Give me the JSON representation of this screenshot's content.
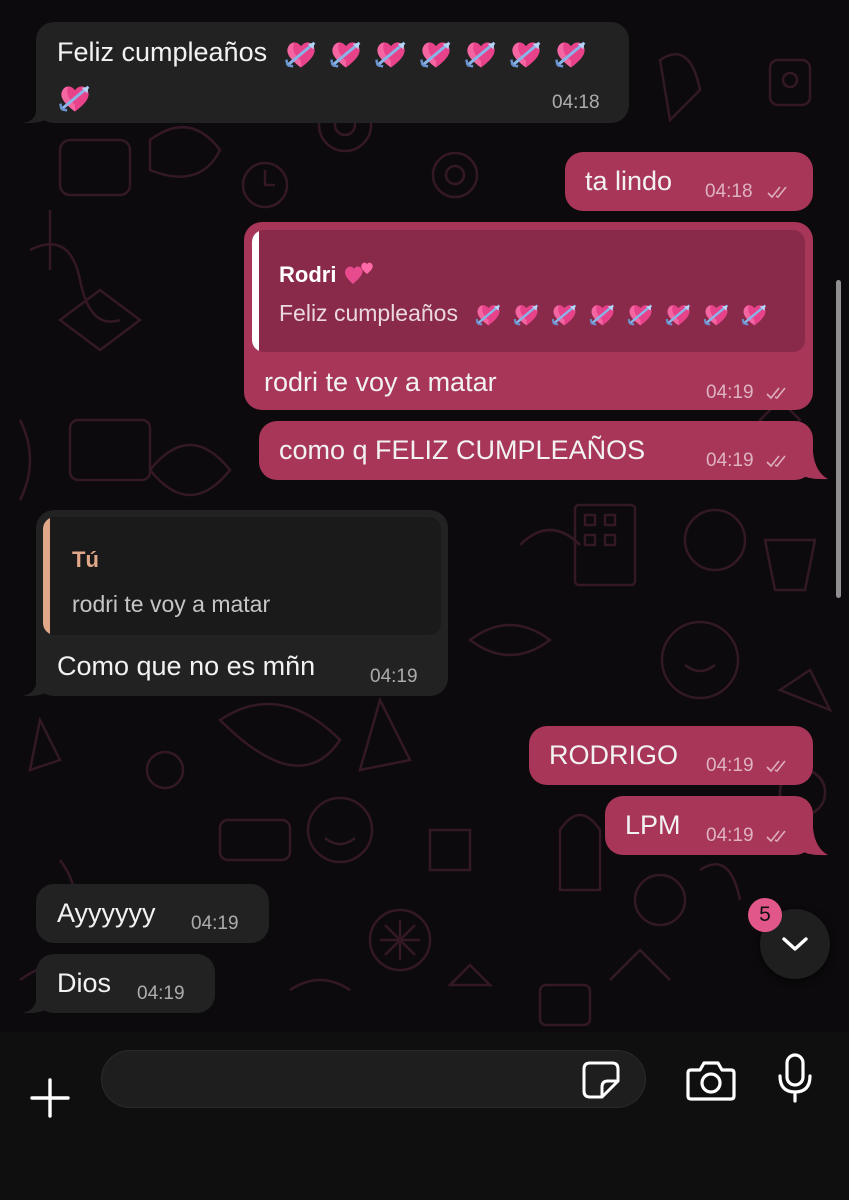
{
  "messages": [
    {
      "direction": "incoming",
      "text": "Feliz cumpleaños",
      "emoji_count": 8,
      "emoji_icon": "heart-with-arrow",
      "time": "04:18"
    },
    {
      "direction": "outgoing",
      "text": "ta lindo",
      "time": "04:18"
    },
    {
      "direction": "outgoing",
      "quote": {
        "author": "Rodri",
        "author_emoji": "two-hearts",
        "text": "Feliz cumpleaños",
        "emoji_count": 8,
        "emoji_icon": "heart-with-arrow"
      },
      "text": "rodri te voy a matar",
      "time": "04:19"
    },
    {
      "direction": "outgoing",
      "text": "como q FELIZ CUMPLEAÑOS",
      "time": "04:19"
    },
    {
      "direction": "incoming",
      "quote": {
        "author": "Tú",
        "text": "rodri te voy a matar"
      },
      "text": "Como que no es mñn",
      "time": "04:19"
    },
    {
      "direction": "outgoing",
      "text": "RODRIGO",
      "time": "04:19"
    },
    {
      "direction": "outgoing",
      "text": "LPM",
      "time": "04:19"
    },
    {
      "direction": "incoming",
      "text": "Ayyyyyy",
      "time": "04:19"
    },
    {
      "direction": "incoming",
      "text": "Dios",
      "time": "04:19"
    }
  ],
  "scroll_button": {
    "unread_count": "5",
    "icon": "chevron-down-icon"
  },
  "composer": {
    "attach_icon": "plus-icon",
    "sticker_icon": "sticker-icon",
    "camera_icon": "camera-icon",
    "mic_icon": "microphone-icon",
    "input_value": ""
  },
  "colors": {
    "outgoing_bubble": "#a83659",
    "incoming_bubble": "#222223",
    "quote_out_bg": "#8a2a4a",
    "quote_in_bg": "#1a1a1b",
    "quote_out_bar": "#ffffff",
    "quote_in_bar": "#e0a888",
    "badge": "#e2578a",
    "wallpaper_doodle": "#3a1a2a"
  }
}
